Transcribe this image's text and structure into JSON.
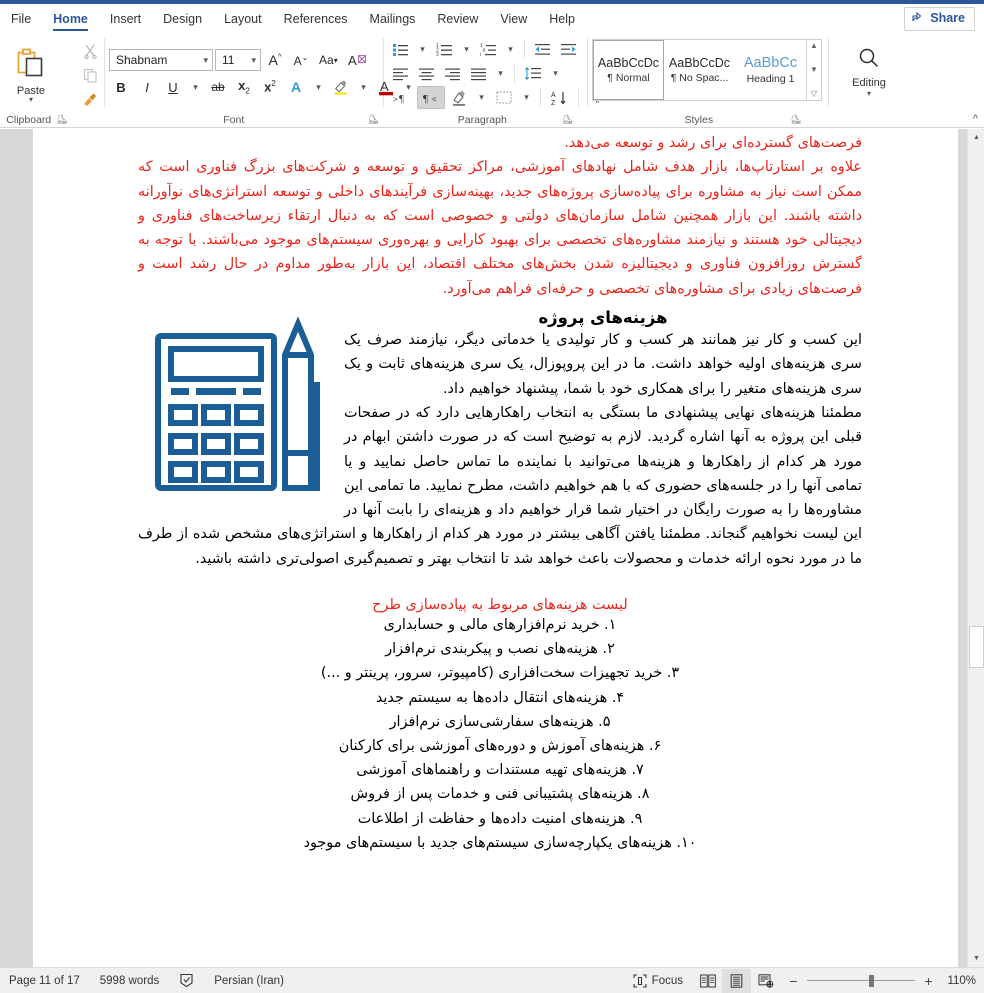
{
  "window": {
    "accent_color": "#2b579a"
  },
  "tabs": [
    {
      "label": "File",
      "active": false
    },
    {
      "label": "Home",
      "active": true
    },
    {
      "label": "Insert",
      "active": false
    },
    {
      "label": "Design",
      "active": false
    },
    {
      "label": "Layout",
      "active": false
    },
    {
      "label": "References",
      "active": false
    },
    {
      "label": "Mailings",
      "active": false
    },
    {
      "label": "Review",
      "active": false
    },
    {
      "label": "View",
      "active": false
    },
    {
      "label": "Help",
      "active": false
    }
  ],
  "share": {
    "label": "Share",
    "icon": "share-person-icon"
  },
  "ribbon": {
    "clipboard": {
      "group_label": "Clipboard",
      "paste_label": "Paste",
      "paste_icon": "clipboard-paste-icon",
      "cut_icon": "scissors-icon",
      "copy_icon": "copy-icon",
      "format_painter_icon": "paintbrush-icon",
      "dialog_launcher_icon": "dialog-launcher-icon"
    },
    "font": {
      "group_label": "Font",
      "font_name": "Shabnam",
      "font_size": "11",
      "grow_font_icon": "grow-font-icon",
      "shrink_font_icon": "shrink-font-icon",
      "change_case_icon": "change-case-icon",
      "clear_formatting_icon": "clear-formatting-icon",
      "bold_label": "B",
      "italic_label": "I",
      "underline_label": "U",
      "strikethrough_icon": "strikethrough-icon",
      "subscript_label": "x",
      "superscript_label": "x",
      "text_effects_icon": "text-effects-icon",
      "highlight_icon": "text-highlight-icon",
      "font_color_icon": "font-color-icon",
      "dialog_launcher_icon": "dialog-launcher-icon"
    },
    "paragraph": {
      "group_label": "Paragraph",
      "bullets_icon": "bullets-icon",
      "numbering_icon": "numbering-icon",
      "multilevel_icon": "multilevel-list-icon",
      "decrease_indent_icon": "decrease-indent-icon",
      "increase_indent_icon": "increase-indent-icon",
      "align_left_icon": "align-left-icon",
      "align_center_icon": "align-center-icon",
      "align_right_icon": "align-right-icon",
      "justify_icon": "justify-icon",
      "line_spacing_icon": "line-spacing-icon",
      "ltr_icon": "left-to-right-icon",
      "rtl_icon": "right-to-left-icon",
      "shading_icon": "shading-icon",
      "borders_icon": "borders-icon",
      "sort_icon": "sort-icon",
      "show_marks_icon": "show-paragraph-marks-icon",
      "dialog_launcher_icon": "dialog-launcher-icon"
    },
    "styles": {
      "group_label": "Styles",
      "items": [
        {
          "preview": "AaBbCcDc",
          "name": "¶ Normal",
          "selected": true
        },
        {
          "preview": "AaBbCcDc",
          "name": "¶ No Spac...",
          "selected": false
        },
        {
          "preview": "AaBbCc",
          "name": "Heading 1",
          "selected": false
        }
      ],
      "scroll_up_icon": "chevron-up-icon",
      "scroll_down_icon": "chevron-down-icon",
      "more_icon": "more-styles-icon",
      "dialog_launcher_icon": "dialog-launcher-icon"
    },
    "editing": {
      "label": "Editing",
      "icon": "search-icon",
      "dropdown_icon": "chevron-down-icon"
    },
    "collapse_icon": "collapse-ribbon-icon"
  },
  "document": {
    "red_top_paragraph_lead": "فرصت‌های گسترده‌ای برای رشد و توسعه می‌دهد.",
    "red_top_paragraph": "علاوه بر استارتاپ‌ها، بازار هدف شامل نهادهای آموزشی، مراکز تحقیق و توسعه و شرکت‌های بزرگ فناوری است که ممکن است نیاز به مشاوره برای پیاده‌سازی پروژه‌های جدید، بهینه‌سازی فرآیندهای داخلی و توسعه استراتژی‌های نوآورانه داشته باشند. این بازار همچنین شامل سازمان‌های دولتی و خصوصی است که به دنبال ارتقاء زیرساخت‌های فناوری و دیجیتالی خود هستند و نیازمند مشاوره‌های تخصصی برای بهبود کارایی و بهره‌وری سیستم‌های موجود می‌باشند. با توجه به گسترش روزافزون فناوری و دیجیتالیزه شدن بخش‌های مختلف اقتصاد، این بازار به‌طور مداوم در حال رشد است و فرصت‌های زیادی برای مشاوره‌های تخصصی و حرفه‌ای فراهم می‌آورد.",
    "heading": "هزینه‌های پروژه",
    "body_paragraph_1": "این کسب و کار نیز همانند هر کسب و کار تولیدی یا خدماتی دیگر، نیازمند صرف یک سری هزینه‌های اولیه خواهد داشت. ما در این پروپوزال، یک سری هزینه‌های ثابت و یک سری هزینه‌های متغیر را برای همکاری خود با شما، پیشنهاد خواهیم داد.",
    "body_paragraph_2": "مطمئنا هزینه‌های نهایی پیشنهادی ما بستگی به انتخاب راهکارهایی دارد که در صفحات قبلی این پروژه به آنها اشاره گردید. لازم به توضیح است که در صورت داشتن ابهام در مورد هر کدام از راهکارها و هزینه‌ها می‌توانید با نماینده ما تماس حاصل نمایید و یا تمامی آنها را در جلسه‌های حضوری که با هم خواهیم داشت، مطرح نمایید. ما تمامی این مشاوره‌ها را به صورت رایگان در اختیار شما قرار خواهیم داد و هزینه‌ای را بابت آنها در این لیست نخواهیم گنجاند. مطمئنا یافتن آگاهی بیشتر در مورد هر کدام از راهکارها و استراتژی‌های مشخص شده از طرف ما در مورد نحوه ارائه خدمات و محصولات باعث خواهد شد تا انتخاب بهتر و تصمیم‌گیری اصولی‌تری داشته باشید.",
    "image_caption": "calculator-and-pencil-illustration",
    "list_title": "لیست هزینه‌های مربوط به پیاده‌سازی طرح",
    "list_items": [
      "۱. خرید نرم‌افزارهای مالی و حسابداری",
      "۲. هزینه‌های نصب و پیکربندی نرم‌افزار",
      "۳. خرید تجهیزات سخت‌افزاری (کامپیوتر، سرور، پرینتر و ...)",
      "۴. هزینه‌های انتقال داده‌ها به سیستم جدید",
      "۵. هزینه‌های سفارشی‌سازی نرم‌افزار",
      "۶. هزینه‌های آموزش و دوره‌های آموزشی برای کارکنان",
      "۷. هزینه‌های تهیه مستندات و راهنماهای آموزشی",
      "۸. هزینه‌های پشتیبانی فنی و خدمات پس از فروش",
      "۹. هزینه‌های امنیت داده‌ها و حفاظت از اطلاعات",
      "۱۰. هزینه‌های یکپارچه‌سازی سیستم‌های جدید با سیستم‌های موجود"
    ],
    "text_colors": {
      "red": "#e8241a",
      "black": "#000000",
      "image_blue": "#1b5e96"
    }
  },
  "scrollbar": {
    "up_arrow_icon": "scroll-up-arrow-icon",
    "down_arrow_icon": "scroll-down-arrow-icon",
    "thumb": "scroll-thumb"
  },
  "statusbar": {
    "page_info": "Page 11 of 17",
    "word_count": "5998 words",
    "proofing_icon": "proofing-errors-icon",
    "language": "Persian (Iran)",
    "focus_label": "Focus",
    "focus_icon": "focus-mode-icon",
    "read_mode_icon": "read-mode-icon",
    "print_layout_icon": "print-layout-icon",
    "web_layout_icon": "web-layout-icon",
    "zoom_out_label": "−",
    "zoom_in_label": "+",
    "zoom_level": "110%"
  }
}
